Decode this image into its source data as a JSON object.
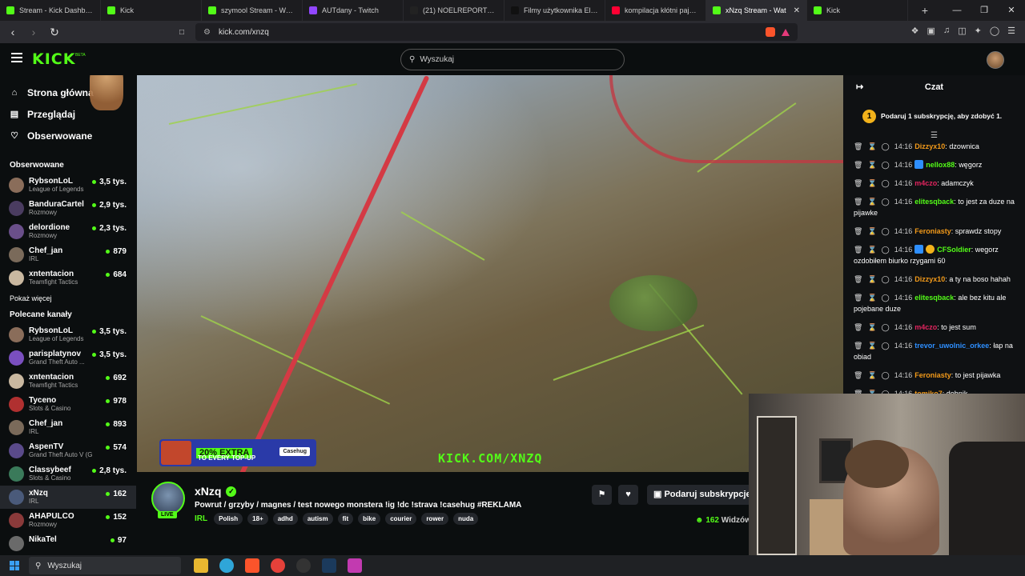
{
  "browser": {
    "tabs": [
      {
        "label": "Stream - Kick Dashboard",
        "color": "#53fc18",
        "active": false
      },
      {
        "label": "Kick",
        "color": "#53fc18",
        "active": false
      },
      {
        "label": "szymool Stream - Watch L",
        "color": "#53fc18",
        "active": false
      },
      {
        "label": "AUTdany - Twitch",
        "color": "#9146ff",
        "active": false
      },
      {
        "label": "(21) NOELREPORTS su ux",
        "color": "#222222",
        "active": false
      },
      {
        "label": "Filmy użytkownika Elisa Ba",
        "color": "#111111",
        "active": false
      },
      {
        "label": "kompilacja kłótni pajalock",
        "color": "#ff0033",
        "active": false
      },
      {
        "label": "xNzq Stream - Wat",
        "color": "#53fc18",
        "active": true
      },
      {
        "label": "Kick",
        "color": "#53fc18",
        "active": false
      }
    ],
    "url": "kick.com/xnzq"
  },
  "header": {
    "logo": "KICK",
    "beta": "BETA",
    "search_placeholder": "Wyszukaj"
  },
  "sidebar": {
    "nav": [
      {
        "label": "Strona główna",
        "icon": "home-icon"
      },
      {
        "label": "Przeglądaj",
        "icon": "browse-icon"
      },
      {
        "label": "Obserwowane",
        "icon": "heart-icon"
      }
    ],
    "followed_title": "Obserwowane",
    "followed": [
      {
        "name": "RybsonLoL",
        "category": "League of Legends",
        "viewers": "3,5 tys.",
        "color": "#8a6d5a"
      },
      {
        "name": "BanduraCartel",
        "category": "Rozmowy",
        "viewers": "2,9 tys.",
        "color": "#4a3c60"
      },
      {
        "name": "delordione",
        "category": "Rozmowy",
        "viewers": "2,3 tys.",
        "color": "#6a4f8a"
      },
      {
        "name": "Chef_jan",
        "category": "IRL",
        "viewers": "879",
        "color": "#7a6a5a"
      },
      {
        "name": "xntentacion",
        "category": "Teamfight Tactics",
        "viewers": "684",
        "color": "#c9b8a0"
      }
    ],
    "show_more": "Pokaż więcej",
    "recommended_title": "Polecane kanały",
    "recommended": [
      {
        "name": "RybsonLoL",
        "category": "League of Legends",
        "viewers": "3,5 tys.",
        "color": "#8a6d5a",
        "active": false
      },
      {
        "name": "parisplatynov",
        "category": "Grand Theft Auto ...",
        "viewers": "3,5 tys.",
        "color": "#7a4fbf",
        "active": false
      },
      {
        "name": "xntentacion",
        "category": "Teamfight Tactics",
        "viewers": "692",
        "color": "#c9b8a0",
        "active": false
      },
      {
        "name": "Tyceno",
        "category": "Slots & Casino",
        "viewers": "978",
        "color": "#b03030",
        "active": false
      },
      {
        "name": "Chef_jan",
        "category": "IRL",
        "viewers": "893",
        "color": "#7a6a5a",
        "active": false
      },
      {
        "name": "AspenTV",
        "category": "Grand Theft Auto V (G...",
        "viewers": "574",
        "color": "#5a4a8a",
        "active": false
      },
      {
        "name": "Classybeef",
        "category": "Slots & Casino",
        "viewers": "2,8 tys.",
        "color": "#3a7a5a",
        "active": false
      },
      {
        "name": "xNzq",
        "category": "IRL",
        "viewers": "162",
        "color": "#4a5a7a",
        "active": true
      },
      {
        "name": "AHAPULCO",
        "category": "Rozmowy",
        "viewers": "152",
        "color": "#8a3a3a",
        "active": false
      },
      {
        "name": "NikaTel",
        "category": "",
        "viewers": "97",
        "color": "#6a6a6a",
        "active": false
      }
    ]
  },
  "video": {
    "promo_pct": "20% EXTRA",
    "promo_text": "TO EVERY TOP-UP",
    "promo_brand": "Casehug",
    "watermark": "KICK.COM/XNZQ"
  },
  "stream": {
    "name": "xNzq",
    "live": "LIVE",
    "title": "Powrut / grzyby / magnes / test nowego monstera !ig !dc !strava !casehug #REKLAMA",
    "category": "IRL",
    "tags": [
      "Polish",
      "18+",
      "adhd",
      "autism",
      "fit",
      "bike",
      "courier",
      "rower",
      "nuda"
    ],
    "subscribe": "Podaruj subskrypcje",
    "viewers": "162",
    "viewers_label": "Widzów"
  },
  "chat": {
    "title": "Czat",
    "goal_number": "1",
    "goal_text": "Podaruj 1 subskrypcję, aby zdobyć 1.",
    "messages": [
      {
        "time": "14:16",
        "user": "Dizzyx10",
        "color": "#f29a1a",
        "text": "dzownica"
      },
      {
        "time": "14:16",
        "user": "nellox88",
        "color": "#53fc18",
        "text": "węgorz"
      },
      {
        "time": "14:16",
        "user": "m4czo",
        "color": "#e0245e",
        "text": "adamczyk"
      },
      {
        "time": "14:16",
        "user": "elitesqback",
        "color": "#53fc18",
        "text": "to jest za duze na pijawke"
      },
      {
        "time": "14:16",
        "user": "Feroniasty",
        "color": "#f29a1a",
        "text": "sprawdz stopy"
      },
      {
        "time": "14:16",
        "user": "CFSoldier",
        "color": "#53fc18",
        "text": "wegorz ozdobiłem biurko rzygami 60"
      },
      {
        "time": "14:16",
        "user": "Dizzyx10",
        "color": "#f29a1a",
        "text": "a ty na boso hahah"
      },
      {
        "time": "14:16",
        "user": "elitesqback",
        "color": "#53fc18",
        "text": "ale bez kitu ale pojebane duze"
      },
      {
        "time": "14:16",
        "user": "m4czo",
        "color": "#e0245e",
        "text": "to jest sum"
      },
      {
        "time": "14:16",
        "user": "trevor_uwolnic_orkee",
        "color": "#2e8fff",
        "text": "łap na obiad"
      },
      {
        "time": "14:16",
        "user": "Feroniasty",
        "color": "#f29a1a",
        "text": "to jest pijawka"
      },
      {
        "time": "14:16",
        "user": "tomiko7",
        "color": "#f29a1a",
        "text": "dobnik"
      }
    ]
  },
  "taskbar": {
    "search": "Wyszukaj"
  }
}
